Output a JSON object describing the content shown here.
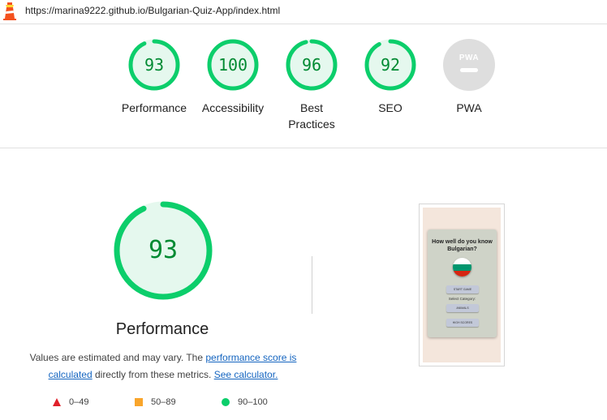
{
  "url": "https://marina9222.github.io/Bulgarian-Quiz-App/index.html",
  "colors": {
    "pass": "#0cce6b",
    "pass_text": "#008a32",
    "pass_bg": "#e5f8ee",
    "average": "#f9a52b",
    "fail": "#e0202a",
    "pwa_gray": "#dedede"
  },
  "categories": [
    {
      "label": "Performance",
      "score": "93",
      "value": 0.93
    },
    {
      "label": "Accessibility",
      "score": "100",
      "value": 1.0
    },
    {
      "label": "Best Practices",
      "score": "96",
      "value": 0.96
    },
    {
      "label": "SEO",
      "score": "92",
      "value": 0.92
    },
    {
      "label": "PWA",
      "icon": "pwa-badge-icon"
    }
  ],
  "detail": {
    "score": "93",
    "value": 0.93,
    "title": "Performance",
    "desc_prefix": "Values are estimated and may vary. The ",
    "link_score": "performance score is calculated",
    "desc_middle": " directly from these metrics. ",
    "link_calc": "See calculator."
  },
  "legend": [
    {
      "range": "0–49",
      "icon": "triangle-fail-icon"
    },
    {
      "range": "50–89",
      "icon": "square-average-icon"
    },
    {
      "range": "90–100",
      "icon": "circle-pass-icon"
    }
  ],
  "screenshot": {
    "title": "How well do you know Bulgarian?",
    "start_button": "START GAME",
    "select_label": "Select Category:",
    "select_value": "ANIMALS",
    "scores_button": "HIGH SCORES"
  }
}
